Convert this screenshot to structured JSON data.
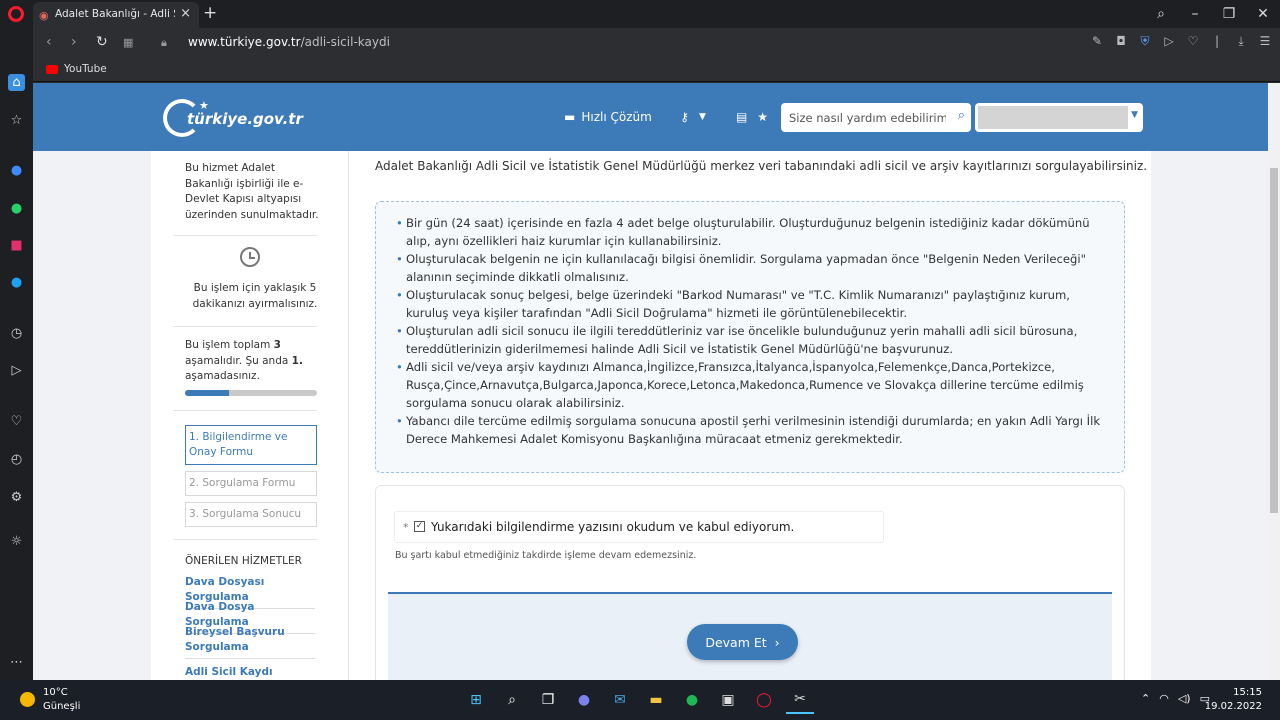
{
  "browser": {
    "tab_title": "Adalet Bakanlığı - Adli Sicil Kaydı",
    "url_domain": "www.türkiye.gov.tr",
    "url_path": "/adli-sicil-kaydi",
    "bookmark_youtube": "YouTube"
  },
  "header": {
    "logo_text": "türkiye.gov.tr",
    "quick_solution_label": "Hızlı Çözüm",
    "search_placeholder": "Size nasıl yardım edebilirim?"
  },
  "left_panel": {
    "service_info": "Bu hizmet Adalet Bakanlığı işbirliği ile e-Devlet Kapısı altyapısı üzerinden sunulmaktadır.",
    "time_info": "Bu işlem için yaklaşık 5 dakikanızı ayırmalısınız.",
    "steps_total_prefix": "Bu işlem toplam ",
    "steps_total": "3",
    "steps_mid": " aşamalıdır. Şu anda ",
    "steps_current": "1.",
    "steps_suffix": " aşamadasınız.",
    "progress_fraction": 0.333,
    "steps": [
      "1. Bilgilendirme ve Onay Formu",
      "2. Sorgulama Formu",
      "3. Sorgulama Sonucu"
    ],
    "recommended_title": "ÖNERİLEN HİZMETLER",
    "recommended": [
      "Dava Dosyası Sorgulama",
      "Dava Dosya Sorgulama",
      "Bireysel Başvuru Sorgulama",
      "Adli Sicil Kaydı"
    ]
  },
  "main": {
    "intro": "Adalet Bakanlığı Adli Sicil ve İstatistik Genel Müdürlüğü merkez veri tabanındaki adli sicil ve arşiv kayıtlarınızı sorgulayabilirsiniz.",
    "info_items": [
      "Bir gün (24 saat) içerisinde en fazla 4 adet belge oluşturulabilir. Oluşturduğunuz belgenin istediğiniz kadar dökümünü alıp, aynı özellikleri haiz kurumlar için kullanabilirsiniz.",
      "Oluşturulacak belgenin ne için kullanılacağı bilgisi önemlidir. Sorgulama yapmadan önce \"Belgenin Neden Verileceği\" alanının seçiminde dikkatli olmalısınız.",
      "Oluşturulacak sonuç belgesi, belge üzerindeki \"Barkod Numarası\" ve \"T.C. Kimlik Numaranızı\" paylaştığınız kurum, kuruluş veya kişiler tarafından \"Adli Sicil Doğrulama\" hizmeti ile görüntülenebilecektir.",
      "Oluşturulan adli sicil sonucu ile ilgili tereddütleriniz var ise öncelikle bulunduğunuz yerin mahalli adli sicil bürosuna, tereddütlerinizin giderilmemesi halinde Adli Sicil ve İstatistik Genel Müdürlüğü'ne başvurunuz.",
      "Adli sicil ve/veya arşiv kaydınızı Almanca,İngilizce,Fransızca,İtalyanca,İspanyolca,Felemenkçe,Danca,Portekizce, Rusça,Çince,Arnavutça,Bulgarca,Japonca,Korece,Letonca,Makedonca,Rumence ve Slovakça dillerine tercüme edilmiş sorgulama sonucu olarak alabilirsiniz.",
      "Yabancı dile tercüme edilmiş sorgulama sonucuna apostil şerhi verilmesinin istendiği durumlarda; en yakın Adli Yargı İlk Derece Mahkemesi Adalet Komisyonu Başkanlığına müracaat etmeniz gerekmektedir."
    ],
    "consent_required_mark": "*",
    "consent_label": "Yukarıdaki bilgilendirme yazısını okudum ve kabul ediyorum.",
    "consent_hint": "Bu şartı kabul etmediğiniz takdirde işleme devam edemezsiniz.",
    "continue_label": "Devam Et"
  },
  "taskbar": {
    "temperature": "10°C",
    "weather": "Güneşli",
    "time": "15:15",
    "date": "19.02.2022"
  },
  "colors": {
    "brand_blue": "#3c7ab8",
    "opera_red": "#ff1b2d"
  }
}
